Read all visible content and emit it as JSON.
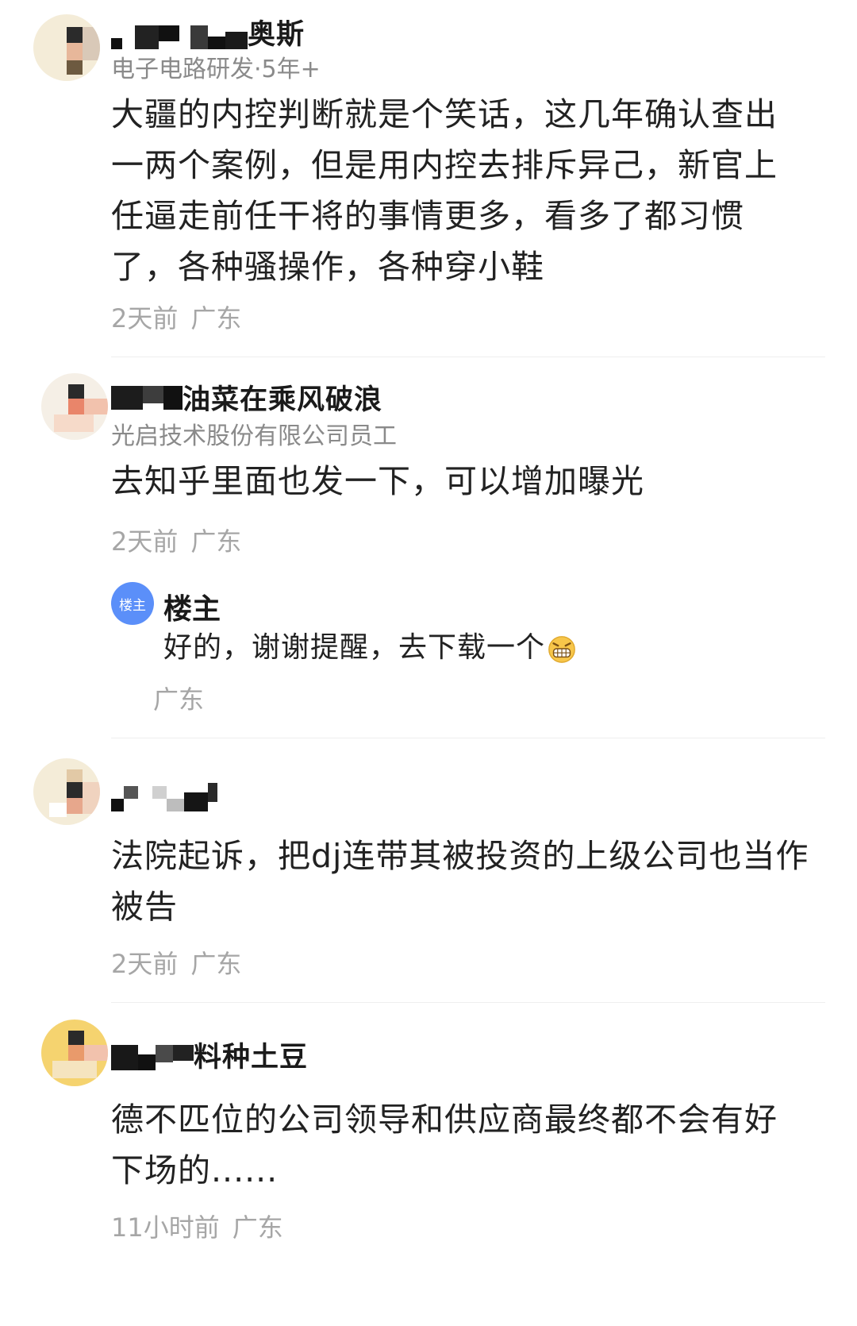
{
  "comments": [
    {
      "name_visible": "奥斯",
      "subtitle": "电子电路研发·5年+",
      "text": "大疆的内控判断就是个笑话，这几年确认查出一两个案例，但是用内控去排斥异己，新官上任逼走前任干将的事情更多，看多了都习惯了，各种骚操作，各种穿小鞋",
      "time": "2天前",
      "location": "广东"
    },
    {
      "name_visible": "油菜在乘风破浪",
      "subtitle": "光启技术股份有限公司员工",
      "text": "去知乎里面也发一下，可以增加曝光",
      "time": "2天前",
      "location": "广东",
      "reply": {
        "badge": "楼主",
        "name": "楼主",
        "text": "好的，谢谢提醒，去下载一个",
        "emoji": "grinning-emoji",
        "location": "广东"
      }
    },
    {
      "name_visible": "",
      "subtitle": "",
      "text": "法院起诉，把dj连带其被投资的上级公司也当作被告",
      "time": "2天前",
      "location": "广东"
    },
    {
      "name_visible": "料种土豆",
      "subtitle": "",
      "text": "德不匹位的公司领导和供应商最终都不会有好下场的......",
      "time": "11小时前",
      "location": "广东"
    }
  ],
  "colors": {
    "name": "#1a1a1a",
    "body": "#222222",
    "meta": "#a6a6a6",
    "subtitle": "#8a8a8a",
    "op_badge": "#5b8ff9"
  }
}
